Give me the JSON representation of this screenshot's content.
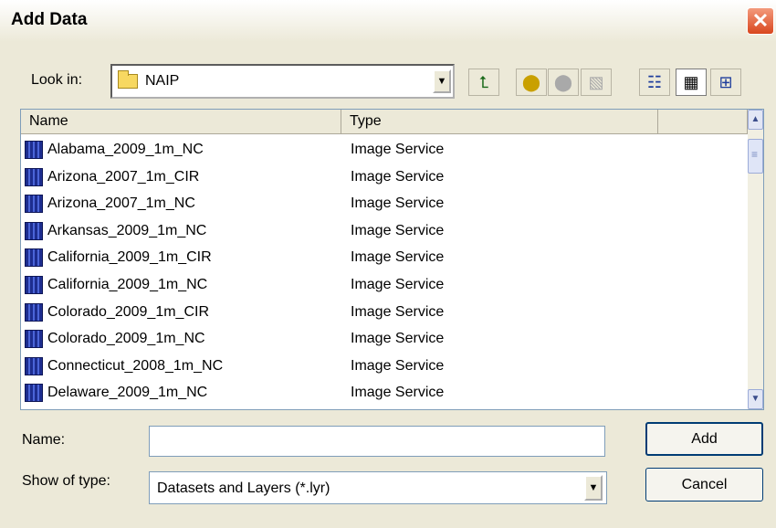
{
  "window": {
    "title": "Add Data",
    "close_icon": "close-icon"
  },
  "lookin": {
    "label": "Look in:",
    "value": "NAIP"
  },
  "toolbar": {
    "up_folder": "⮤",
    "connect": "⬤",
    "disconnect": "⬤",
    "new": "▧",
    "list_view": "☷",
    "details_view": "▦",
    "thumbnails_view": "⊞"
  },
  "columns": [
    "Name",
    "Type"
  ],
  "rows": [
    {
      "name": "Alabama_2009_1m_NC",
      "type": "Image Service"
    },
    {
      "name": "Arizona_2007_1m_CIR",
      "type": "Image Service"
    },
    {
      "name": "Arizona_2007_1m_NC",
      "type": "Image Service"
    },
    {
      "name": "Arkansas_2009_1m_NC",
      "type": "Image Service"
    },
    {
      "name": "California_2009_1m_CIR",
      "type": "Image Service"
    },
    {
      "name": "California_2009_1m_NC",
      "type": "Image Service"
    },
    {
      "name": "Colorado_2009_1m_CIR",
      "type": "Image Service"
    },
    {
      "name": "Colorado_2009_1m_NC",
      "type": "Image Service"
    },
    {
      "name": "Connecticut_2008_1m_NC",
      "type": "Image Service"
    },
    {
      "name": "Delaware_2009_1m_NC",
      "type": "Image Service"
    }
  ],
  "name_field": {
    "label": "Name:",
    "value": ""
  },
  "type_field": {
    "label": "Show of type:",
    "value": "Datasets and Layers (*.lyr)"
  },
  "buttons": {
    "add": "Add",
    "cancel": "Cancel"
  },
  "scroll": {
    "up": "▲",
    "down": "▼"
  },
  "dropdown_arrow": "▼"
}
